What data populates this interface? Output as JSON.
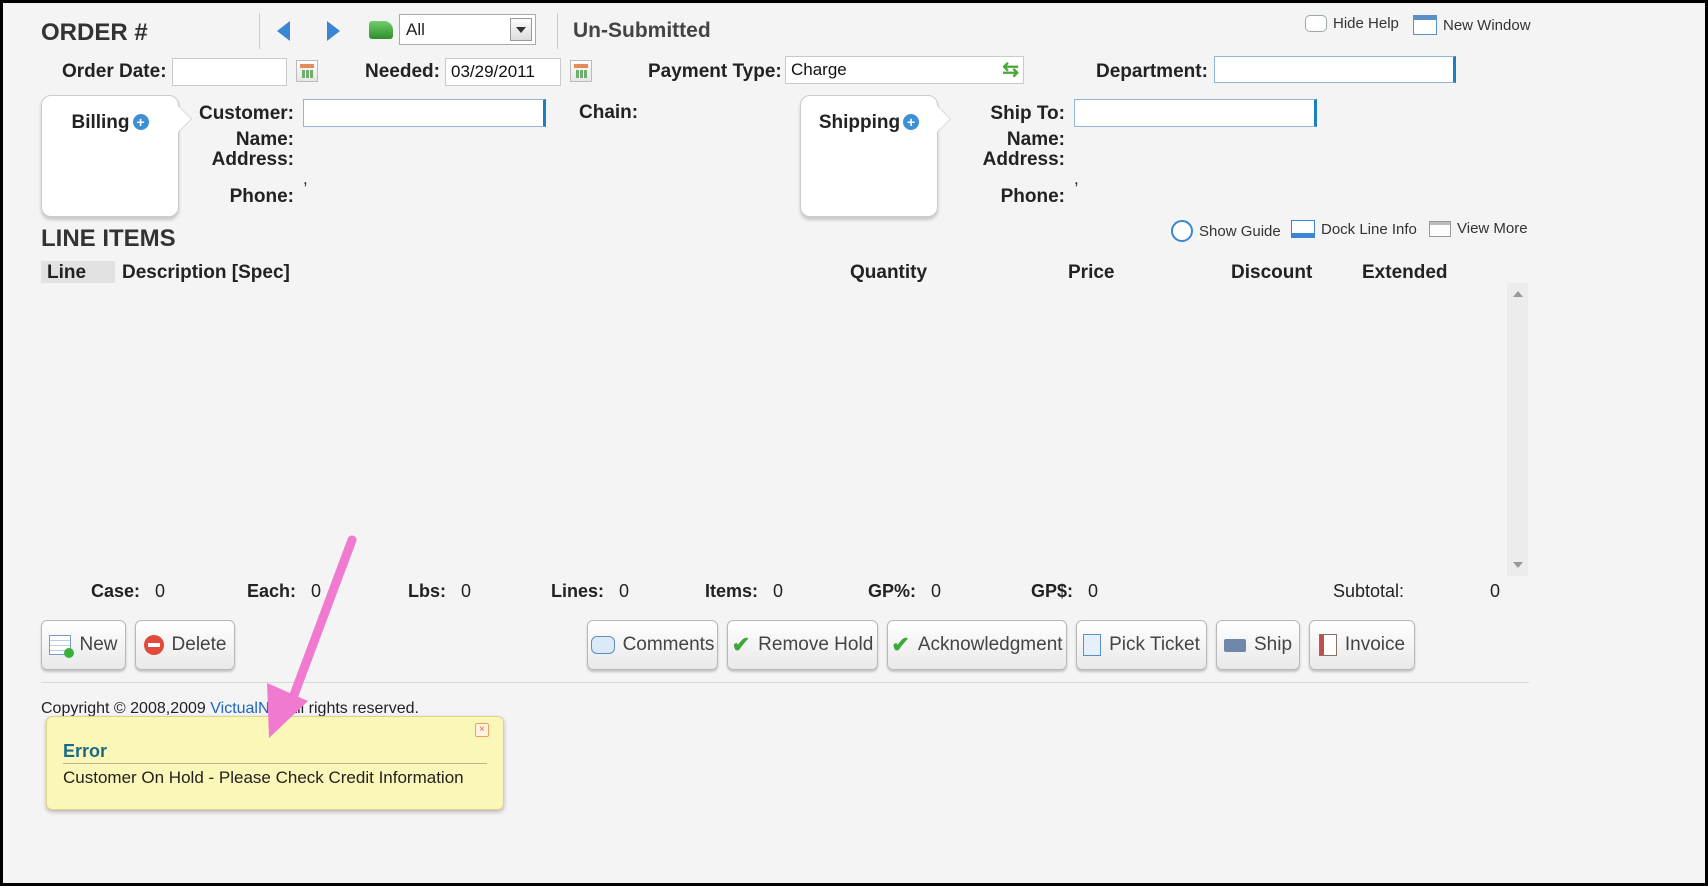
{
  "header": {
    "order_label": "ORDER #",
    "filter_value": "All",
    "status": "Un-Submitted",
    "hide_help": "Hide Help",
    "new_window": "New Window"
  },
  "form": {
    "order_date_label": "Order Date:",
    "order_date_value": "",
    "needed_label": "Needed:",
    "needed_value": "03/29/2011",
    "payment_type_label": "Payment Type:",
    "payment_type_value": "Charge",
    "department_label": "Department:",
    "department_value": ""
  },
  "billing": {
    "tab_label": "Billing",
    "customer_label": "Customer:",
    "name_label": "Name:",
    "address_label": "Address:",
    "phone_label": "Phone:",
    "comma": ",",
    "chain_label": "Chain:"
  },
  "shipping": {
    "tab_label": "Shipping",
    "ship_to_label": "Ship To:",
    "name_label": "Name:",
    "address_label": "Address:",
    "phone_label": "Phone:",
    "comma": ","
  },
  "line_items": {
    "title": "LINE ITEMS",
    "show_guide": "Show Guide",
    "dock_line_info": "Dock Line Info",
    "view_more": "View More",
    "columns": {
      "line": "Line",
      "description": "Description [Spec]",
      "quantity": "Quantity",
      "price": "Price",
      "discount": "Discount",
      "extended": "Extended"
    }
  },
  "totals": {
    "case_label": "Case:",
    "case_value": "0",
    "each_label": "Each:",
    "each_value": "0",
    "lbs_label": "Lbs:",
    "lbs_value": "0",
    "lines_label": "Lines:",
    "lines_value": "0",
    "items_label": "Items:",
    "items_value": "0",
    "gp_pct_label": "GP%:",
    "gp_pct_value": "0",
    "gp_dollar_label": "GP$:",
    "gp_dollar_value": "0",
    "subtotal_label": "Subtotal:",
    "subtotal_value": "0"
  },
  "buttons": {
    "new": "New",
    "delete": "Delete",
    "comments": "Comments",
    "remove_hold": "Remove Hold",
    "acknowledgment": "Acknowledgment",
    "pick_ticket": "Pick Ticket",
    "ship": "Ship",
    "invoice": "Invoice"
  },
  "footer": {
    "copyright_pre": "Copyright © 2008,2009",
    "link_text": "VictualNe",
    "copyright_post": ". All rights reserved."
  },
  "error": {
    "title": "Error",
    "message": "Customer On Hold - Please Check Credit Information"
  },
  "colors": {
    "accent_blue": "#1d7fc1",
    "annotation_pink": "#f07ad0",
    "error_bg": "#fbf7b8",
    "error_title": "#1a6a8a"
  }
}
